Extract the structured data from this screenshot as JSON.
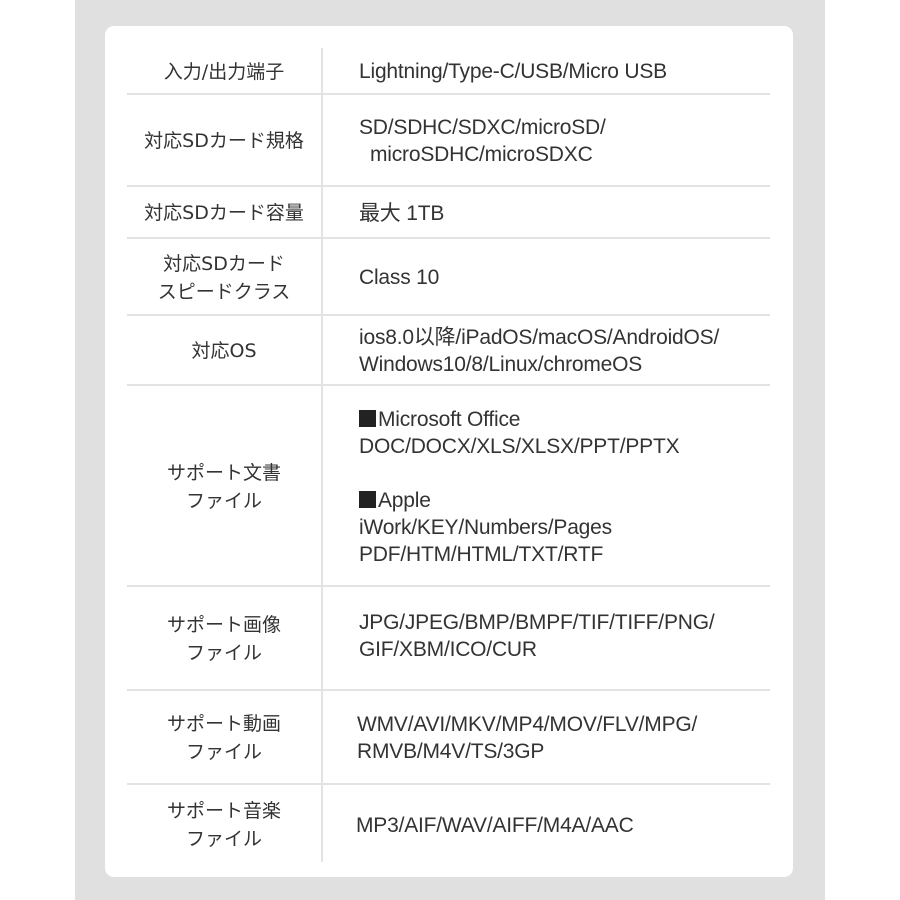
{
  "spec_table": {
    "rows": [
      {
        "label": "入力/出力端子",
        "value_lines": [
          "Lightning/Type-C/USB/Micro USB"
        ]
      },
      {
        "label": "対応SDカード規格",
        "value_lines": [
          "SD/SDHC/SDXC/microSD/",
          "microSDHC/microSDXC"
        ]
      },
      {
        "label": "対応SDカード容量",
        "value_lines": [
          "最大 1TB"
        ]
      },
      {
        "label": "対応SDカード\nスピードクラス",
        "value_lines": [
          "Class 10"
        ]
      },
      {
        "label": "対応OS",
        "value_lines": [
          "ios8.0以降/iPadOS/macOS/AndroidOS/",
          "Windows10/8/Linux/chromeOS"
        ]
      },
      {
        "label": "サポート文書\nファイル",
        "groups": [
          {
            "heading": "Microsoft Office",
            "heading_icon": "black-square-icon",
            "lines": [
              "DOC/DOCX/XLS/XLSX/PPT/PPTX"
            ]
          },
          {
            "heading": "Apple",
            "heading_icon": "black-square-icon",
            "lines": [
              "iWork/KEY/Numbers/Pages",
              "PDF/HTM/HTML/TXT/RTF"
            ]
          }
        ]
      },
      {
        "label": "サポート画像\nファイル",
        "value_lines": [
          "JPG/JPEG/BMP/BMPF/TIF/TIFF/PNG/",
          "GIF/XBM/ICO/CUR"
        ]
      },
      {
        "label": "サポート動画\nファイル",
        "value_lines": [
          "WMV/AVI/MKV/MP4/MOV/FLV/MPG/",
          "RMVB/M4V/TS/3GP"
        ]
      },
      {
        "label": "サポート音楽\nファイル",
        "value_lines": [
          "MP3/AIF/WAV/AIFF/M4A/AAC"
        ]
      }
    ]
  }
}
